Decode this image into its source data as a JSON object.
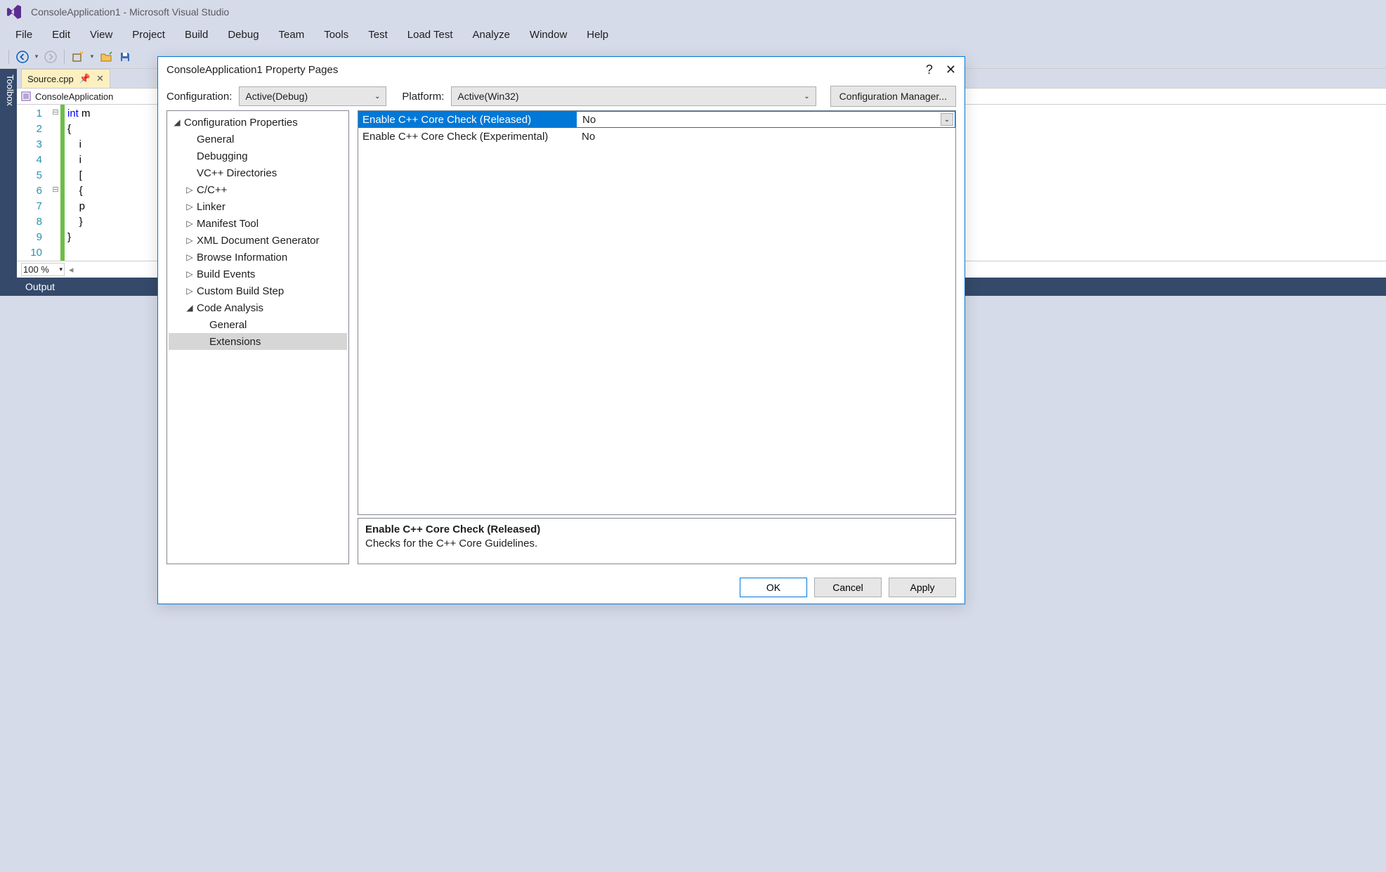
{
  "window_title": "ConsoleApplication1 - Microsoft Visual Studio",
  "menu": [
    "File",
    "Edit",
    "View",
    "Project",
    "Build",
    "Debug",
    "Team",
    "Tools",
    "Test",
    "Load Test",
    "Analyze",
    "Window",
    "Help"
  ],
  "tabs": {
    "active_doc": "Source.cpp"
  },
  "crumb": "ConsoleApplication",
  "code": {
    "line_numbers": [
      "1",
      "2",
      "3",
      "4",
      "5",
      "6",
      "7",
      "8",
      "9",
      "10"
    ],
    "lines": [
      "int m",
      "{",
      "    i",
      "    i",
      "    [",
      "    {",
      "",
      "    p",
      "    }",
      "}"
    ],
    "fold_marks": {
      "0": "⊟",
      "5": "⊟"
    }
  },
  "zoom": "100 %",
  "output_label": "Output",
  "toolbox_label": "Toolbox",
  "dialog": {
    "title": "ConsoleApplication1 Property Pages",
    "config_label": "Configuration:",
    "config_value": "Active(Debug)",
    "platform_label": "Platform:",
    "platform_value": "Active(Win32)",
    "config_mgr": "Configuration Manager...",
    "tree": [
      {
        "indent": 0,
        "arrow": "◢",
        "label": "Configuration Properties"
      },
      {
        "indent": 1,
        "arrow": "",
        "label": "General"
      },
      {
        "indent": 1,
        "arrow": "",
        "label": "Debugging"
      },
      {
        "indent": 1,
        "arrow": "",
        "label": "VC++ Directories"
      },
      {
        "indent": 1,
        "arrow": "▷",
        "label": "C/C++"
      },
      {
        "indent": 1,
        "arrow": "▷",
        "label": "Linker"
      },
      {
        "indent": 1,
        "arrow": "▷",
        "label": "Manifest Tool"
      },
      {
        "indent": 1,
        "arrow": "▷",
        "label": "XML Document Generator"
      },
      {
        "indent": 1,
        "arrow": "▷",
        "label": "Browse Information"
      },
      {
        "indent": 1,
        "arrow": "▷",
        "label": "Build Events"
      },
      {
        "indent": 1,
        "arrow": "▷",
        "label": "Custom Build Step"
      },
      {
        "indent": 1,
        "arrow": "◢",
        "label": "Code Analysis"
      },
      {
        "indent": 2,
        "arrow": "",
        "label": "General"
      },
      {
        "indent": 2,
        "arrow": "",
        "label": "Extensions",
        "selected": true
      }
    ],
    "properties": [
      {
        "name": "Enable C++ Core Check (Released)",
        "value": "No",
        "selected": true
      },
      {
        "name": "Enable C++ Core Check (Experimental)",
        "value": "No"
      }
    ],
    "desc_title": "Enable C++ Core Check (Released)",
    "desc_text": "Checks for the C++ Core Guidelines.",
    "buttons": {
      "ok": "OK",
      "cancel": "Cancel",
      "apply": "Apply"
    }
  }
}
